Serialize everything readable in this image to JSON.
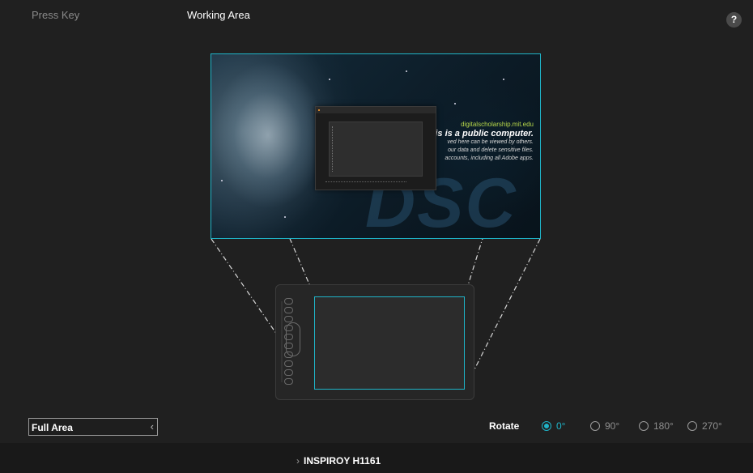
{
  "tabs": {
    "press_key": "Press Key",
    "working_area": "Working Area"
  },
  "help": {
    "label": "?"
  },
  "screen_preview": {
    "website": "digitalscholarship.mit.edu",
    "headline": "This is a public computer.",
    "lines": [
      "ved here can be viewed by others.",
      "our data and delete sensitive files.",
      "accounts, including all Adobe apps."
    ],
    "watermark": "DSC"
  },
  "area_dropdown": {
    "value": "Full Area"
  },
  "rotate": {
    "label": "Rotate",
    "options": [
      "0°",
      "90°",
      "180°",
      "270°"
    ],
    "selected": "0°"
  },
  "device": {
    "name": "INSPIROY H1161"
  },
  "colors": {
    "accent": "#1fb4c8",
    "background": "#202020"
  }
}
